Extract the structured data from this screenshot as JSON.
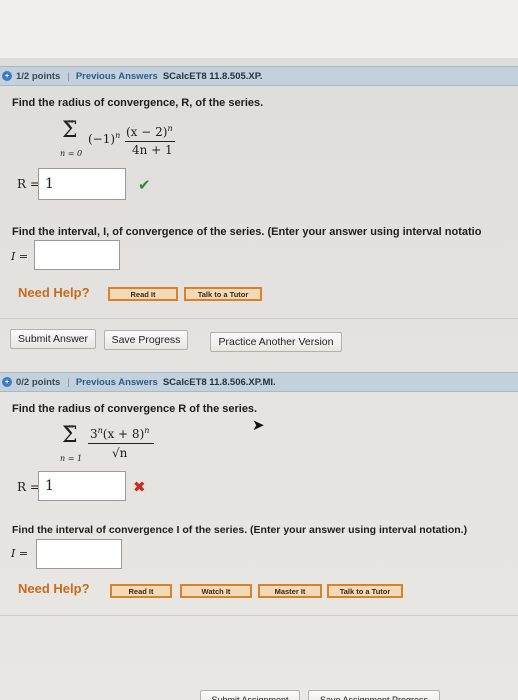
{
  "q1": {
    "points": "1/2 points",
    "separator": "|",
    "previous_answers": "Previous Answers",
    "code": "SCalcET8 11.8.505.XP.",
    "prompt_radius": "Find the radius of convergence, R, of the series.",
    "sum_top": "∞",
    "sum_bottom": "n = 0",
    "term_sign": "(−1)",
    "term_sign_exp": "n",
    "numerator": "(x − 2)",
    "numerator_exp": "n",
    "denominator": "4n + 1",
    "r_label": "R =",
    "r_value": "1",
    "prompt_interval": "Find the interval, I, of convergence of the series. (Enter your answer using interval notatio",
    "i_label": "I =",
    "i_value": "",
    "need_help": "Need Help?",
    "read_it": "Read It",
    "talk_tutor": "Talk to a Tutor"
  },
  "actions": {
    "submit": "Submit Answer",
    "save": "Save Progress",
    "practice": "Practice Another Version"
  },
  "q2": {
    "points": "0/2 points",
    "separator": "|",
    "previous_answers": "Previous Answers",
    "code": "SCalcET8 11.8.506.XP.MI.",
    "prompt_radius": "Find the radius of convergence R of the series.",
    "sum_top": "∞",
    "sum_bottom": "n = 1",
    "numerator": "3",
    "numerator_exp": "n",
    "numerator_rest": "(x + 8)",
    "numerator_rest_exp": "n",
    "denominator": "√n",
    "r_label": "R =",
    "r_value": "1",
    "prompt_interval": "Find the interval of convergence I of the series. (Enter your answer using interval notation.)",
    "i_label": "I =",
    "i_value": "",
    "need_help": "Need Help?",
    "read_it": "Read It",
    "watch_it": "Watch It",
    "master_it": "Master It",
    "talk_tutor": "Talk to a Tutor"
  },
  "footer": {
    "submit_assignment": "Submit Assignment",
    "save_assignment": "Save Assignment Progress"
  },
  "colors": {
    "correct": "#2e8b2e",
    "incorrect": "#d0271d",
    "help_orange": "#c96b1b",
    "header_blue": "#c3d1dc"
  }
}
